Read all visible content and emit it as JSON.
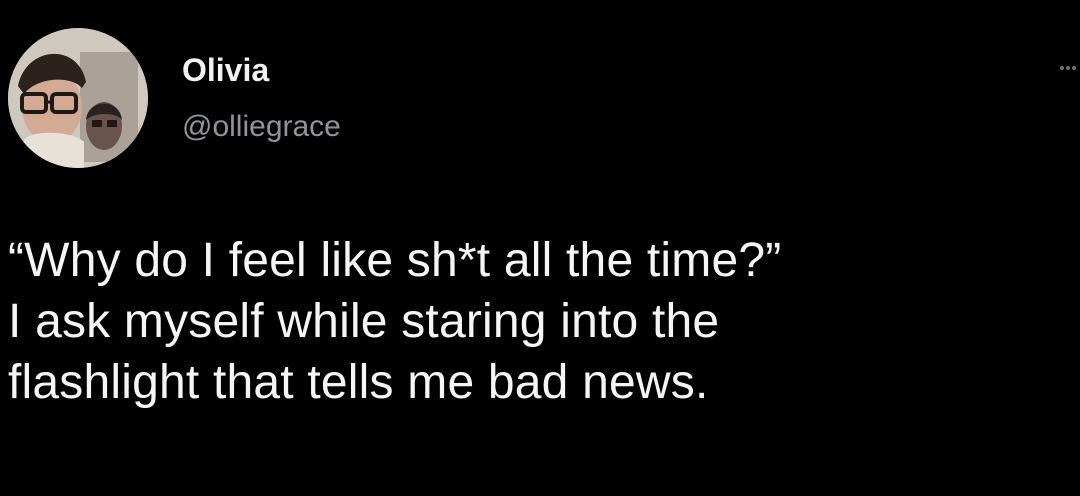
{
  "author": {
    "display_name": "Olivia",
    "handle": "@olliegrace",
    "avatar_icon": "profile-photo-icon"
  },
  "menu": {
    "icon": "more-options-icon"
  },
  "tweet": {
    "lines": [
      "“Why do I feel like sh*t all the time?”",
      "I ask myself while staring into the",
      "flashlight that tells me bad news."
    ]
  },
  "colors": {
    "background": "#000000",
    "name": "#f2f2f2",
    "handle": "#8f9599",
    "text": "#f5f5f5"
  }
}
